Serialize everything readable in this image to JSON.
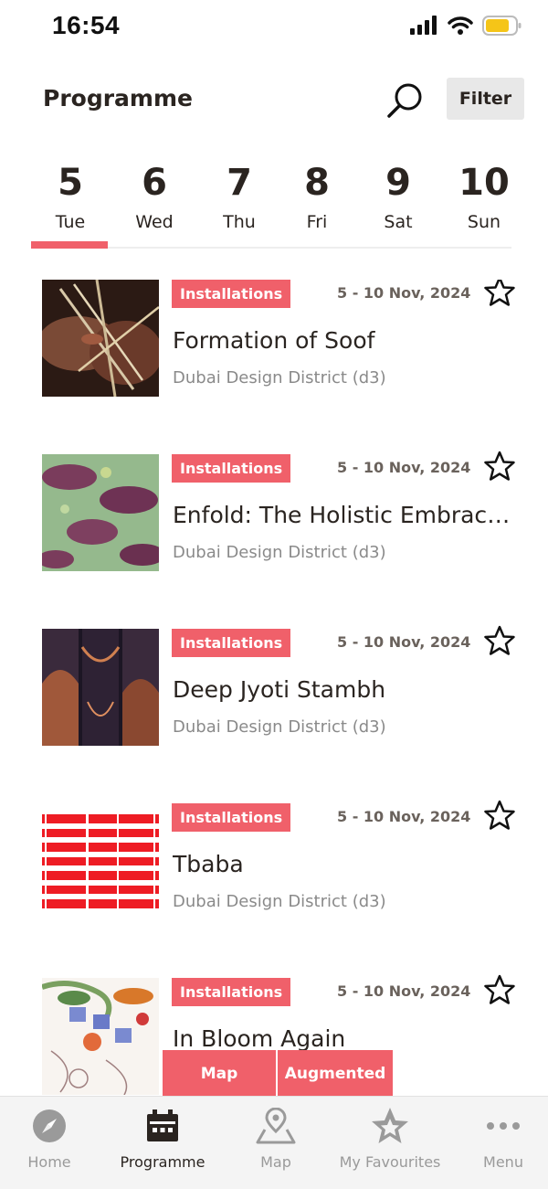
{
  "status": {
    "time": "16:54"
  },
  "header": {
    "title": "Programme",
    "filter_label": "Filter"
  },
  "dates": [
    {
      "num": "5",
      "day": "Tue",
      "active": true
    },
    {
      "num": "6",
      "day": "Wed"
    },
    {
      "num": "7",
      "day": "Thu"
    },
    {
      "num": "8",
      "day": "Fri"
    },
    {
      "num": "9",
      "day": "Sat"
    },
    {
      "num": "10",
      "day": "Sun"
    }
  ],
  "events": [
    {
      "category": "Installations",
      "dates": "5 - 10 Nov, 2024",
      "title": "Formation of Soof",
      "location": "Dubai Design District (d3)"
    },
    {
      "category": "Installations",
      "dates": "5 - 10 Nov, 2024",
      "title": "Enfold: The Holistic Embrace o...",
      "location": "Dubai Design District (d3)"
    },
    {
      "category": "Installations",
      "dates": "5 - 10 Nov, 2024",
      "title": "Deep Jyoti Stambh",
      "location": "Dubai Design District (d3)"
    },
    {
      "category": "Installations",
      "dates": "5 - 10 Nov, 2024",
      "title": "Tbaba",
      "location": "Dubai Design District (d3)"
    },
    {
      "category": "Installations",
      "dates": "5 - 10 Nov, 2024",
      "title": "In Bloom Again",
      "location": ""
    }
  ],
  "floating": {
    "map_label": "Map",
    "augmented_label": "Augmented"
  },
  "nav": [
    {
      "label": "Home",
      "icon": "compass-icon"
    },
    {
      "label": "Programme",
      "icon": "calendar-icon",
      "active": true
    },
    {
      "label": "Map",
      "icon": "map-pin-icon"
    },
    {
      "label": "My Favourites",
      "icon": "star-icon"
    },
    {
      "label": "Menu",
      "icon": "more-dots-icon"
    }
  ],
  "colors": {
    "accent": "#f0606a",
    "text": "#2a2420",
    "muted": "#8a8a8a"
  }
}
